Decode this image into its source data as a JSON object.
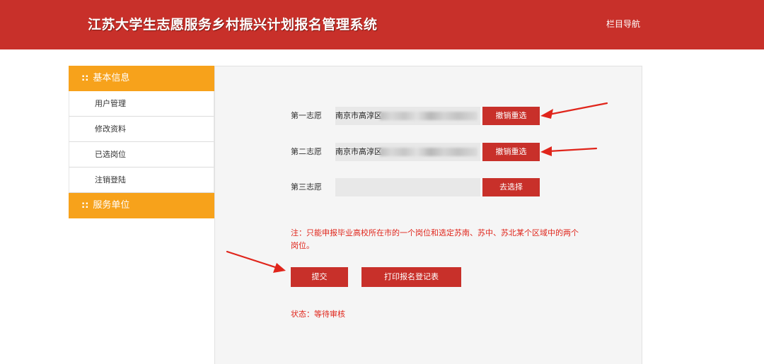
{
  "header": {
    "title": "江苏大学生志愿服务乡村振兴计划报名管理系统",
    "nav_label": "栏目导航"
  },
  "sidebar": {
    "section_basic": "基本信息",
    "items": [
      {
        "label": "用户管理"
      },
      {
        "label": "修改资料"
      },
      {
        "label": "已选岗位"
      },
      {
        "label": "注销登陆"
      }
    ],
    "section_service": "服务单位",
    "section_prefix": "::"
  },
  "main": {
    "choices": [
      {
        "label": "第一志愿",
        "value": "南京市高淳区",
        "button": "撤销重选"
      },
      {
        "label": "第二志愿",
        "value": "南京市高淳区",
        "button": "撤销重选"
      },
      {
        "label": "第三志愿",
        "value": "",
        "button": "去选择"
      }
    ],
    "note": "注：只能申报毕业高校所在市的一个岗位和选定苏南、苏中、苏北某个区域中的两个岗位。",
    "submit_label": "提交",
    "print_label": "打印报名登记表",
    "status": "状态：等待审核"
  },
  "colors": {
    "header_bg": "#c8302a",
    "sidebar_head_bg": "#f7a21b",
    "button_bg": "#c8302a",
    "note_text": "#e0251b",
    "arrow": "#e0251b"
  }
}
